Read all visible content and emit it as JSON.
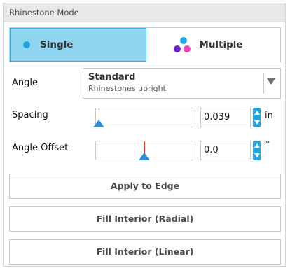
{
  "panel": {
    "title": "Rhinestone Mode"
  },
  "mode": {
    "selected": "single",
    "single_label": "Single",
    "multiple_label": "Multiple",
    "accent": "#8fd5f0"
  },
  "angle": {
    "label": "Angle",
    "selected": "Standard",
    "description": "Rhinestones upright"
  },
  "spacing": {
    "label": "Spacing",
    "value": "0.039",
    "unit": "in",
    "slider_position": 0.03
  },
  "angle_offset": {
    "label": "Angle Offset",
    "value": "0.0",
    "unit": "°",
    "slider_position": 0.5
  },
  "actions": {
    "apply_to_edge": "Apply to Edge",
    "fill_radial": "Fill Interior (Radial)",
    "fill_linear": "Fill Interior (Linear)"
  },
  "icons": {
    "single_dot": "circle-icon",
    "multiple_dots": "multi-dot-icon",
    "dropdown": "chevron-down-icon",
    "spinner_up": "arrow-up-icon",
    "spinner_down": "arrow-down-icon"
  }
}
